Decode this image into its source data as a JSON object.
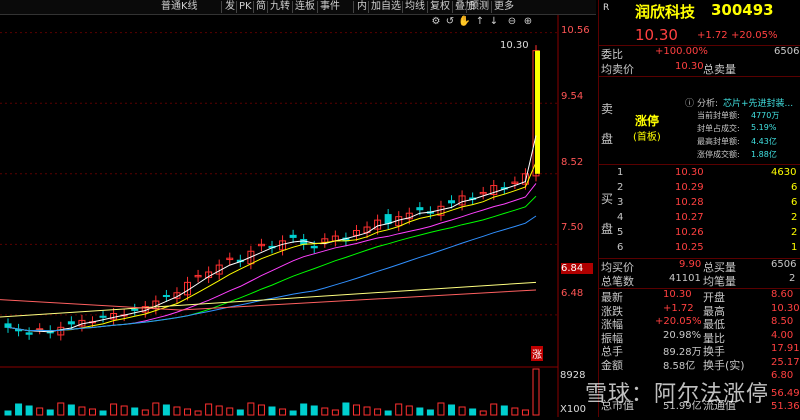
{
  "toolbar": {
    "items": [
      "普通K线",
      "发",
      "PK",
      "简",
      "九转",
      "连板",
      "事件",
      "内",
      "加自选",
      "均线",
      "复权",
      "叠加",
      "预测",
      "更多"
    ],
    "icons": [
      "gear-icon",
      "undo-icon",
      "hand-icon",
      "up-arrow-icon",
      "down-arrow-icon",
      "zoom-out-icon",
      "zoom-in-icon"
    ]
  },
  "chart": {
    "y_labels": [
      "10.56",
      "9.54",
      "8.52",
      "7.50",
      "6.84",
      "6.48"
    ],
    "peak_label": "10.30",
    "limit_tag": "涨",
    "volume_labels": [
      "8928",
      "X100"
    ],
    "colors": {
      "up": "#ff3030",
      "down": "#00d0d0",
      "ma5": "#ffffff",
      "ma10": "#ffff00",
      "ma20": "#ff40ff",
      "ma30": "#00ff00",
      "ma60": "#3090ff",
      "ma120": "#ffff80",
      "ma250": "#ff6060"
    },
    "chart_data": {
      "type": "candlestick",
      "title": "",
      "ylim": [
        5.9,
        10.7
      ],
      "series": [
        {
          "name": "price",
          "values": [
            6.3,
            6.25,
            6.2,
            6.28,
            6.22,
            6.3,
            6.35,
            6.4,
            6.38,
            6.45,
            6.5,
            6.48,
            6.55,
            6.6,
            6.68,
            6.75,
            6.8,
            6.95,
            7.05,
            7.1,
            7.2,
            7.3,
            7.25,
            7.4,
            7.5,
            7.45,
            7.55,
            7.6,
            7.5,
            7.45,
            7.58,
            7.62,
            7.55,
            7.7,
            7.75,
            7.85,
            7.8,
            7.9,
            7.95,
            8.0,
            7.95,
            8.05,
            8.1,
            8.2,
            8.15,
            8.25,
            8.35,
            8.3,
            8.4,
            8.52,
            10.3
          ]
        }
      ]
    }
  },
  "panel": {
    "stock_name": "润欣科技",
    "stock_code": "300493",
    "r_label": "R",
    "price": "10.30",
    "change": "+1.72",
    "change_pct": "+20.05%",
    "weibi_label": "委比",
    "weibi_value": "+100.00%",
    "weibi_right": "6506",
    "avg_sell_label": "均卖价",
    "avg_sell_value": "10.30",
    "total_sell_label": "总卖量",
    "sell_side": [
      "卖",
      "盘"
    ],
    "limit_up": "涨停",
    "limit_sub": "(首板)",
    "analysis_label": "分析:",
    "analysis_value": "芯片+先进封装...",
    "seal": [
      {
        "label": "当前封单额:",
        "value": "4770万"
      },
      {
        "label": "封单占成交:",
        "value": "5.19%"
      },
      {
        "label": "最高封单额:",
        "value": "4.43亿"
      },
      {
        "label": "涨停成交额:",
        "value": "1.88亿"
      }
    ],
    "buy_side": [
      "买",
      "盘"
    ],
    "bids": [
      {
        "level": "1",
        "price": "10.30",
        "vol": "4630"
      },
      {
        "level": "2",
        "price": "10.29",
        "vol": "6"
      },
      {
        "level": "3",
        "price": "10.28",
        "vol": "6"
      },
      {
        "level": "4",
        "price": "10.27",
        "vol": "2"
      },
      {
        "level": "5",
        "price": "10.26",
        "vol": "2"
      },
      {
        "level": "6",
        "price": "10.25",
        "vol": "1"
      }
    ],
    "avg_buy_label": "均买价",
    "avg_buy_value": "9.90",
    "total_buy_label": "总买量",
    "total_buy_value": "6506",
    "total_orders_label": "总笔数",
    "total_orders_value": "41101",
    "avg_orders_label": "均笔量",
    "avg_orders_value": "2",
    "stats": [
      {
        "l": "最新",
        "v": "10.30",
        "l2": "开盘",
        "v2": "8.60"
      },
      {
        "l": "涨跌",
        "v": "+1.72",
        "l2": "最高",
        "v2": "10.30"
      },
      {
        "l": "涨幅",
        "v": "+20.05%",
        "l2": "最低",
        "v2": "8.50"
      },
      {
        "l": "振幅",
        "v": "20.98%",
        "l2": "量比",
        "v2": "4.00"
      },
      {
        "l": "总手",
        "v": "89.28万",
        "l2": "换手",
        "v2": "17.91%"
      },
      {
        "l": "金额",
        "v": "8.58亿",
        "l2": "换手(实)",
        "v2": "25.17%"
      },
      {
        "l": "",
        "v": "",
        "l2": "",
        "v2": "6.80"
      },
      {
        "l": "",
        "v": "",
        "l2": "",
        "v2": "56.49万"
      },
      {
        "l": "总市值",
        "v": "51.99亿",
        "l2": "流通值",
        "v2": "51.36亿"
      }
    ]
  },
  "watermark": "雪球：阿尔法涨停"
}
